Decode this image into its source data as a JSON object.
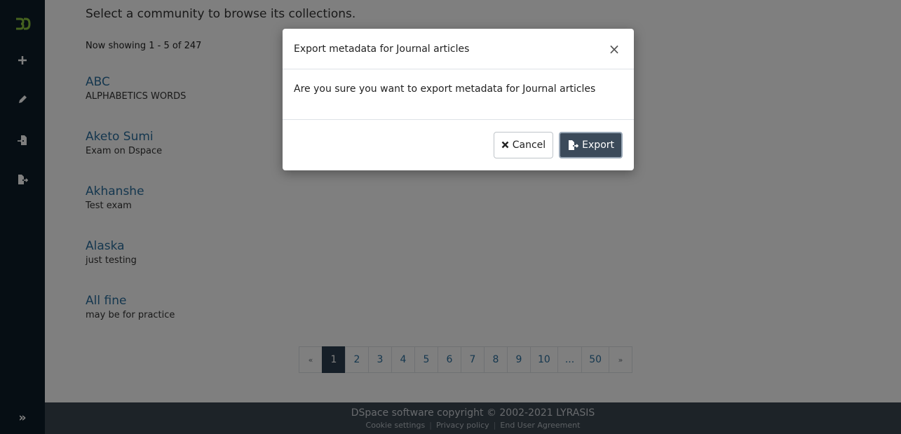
{
  "sidebar": {
    "expand_icon": "»"
  },
  "main": {
    "intro": "Select a community to browse its collections.",
    "showing": "Now showing 1 - 5 of 247",
    "items": [
      {
        "title": "ABC",
        "desc": "ALPHABETICS WORDS"
      },
      {
        "title": "Aketo Sumi",
        "desc": "Exam on Dspace"
      },
      {
        "title": "Akhanshe",
        "desc": "Test exam"
      },
      {
        "title": "Alaska",
        "desc": "just testing"
      },
      {
        "title": "All fine",
        "desc": "may be for practice"
      }
    ],
    "pagination": [
      "«",
      "1",
      "2",
      "3",
      "4",
      "5",
      "6",
      "7",
      "8",
      "9",
      "10",
      "...",
      "50",
      "»"
    ],
    "active_page": "1"
  },
  "footer": {
    "copyright": "DSpace software copyright © 2002-2021 LYRASIS",
    "cookie": "Cookie settings",
    "privacy": "Privacy policy",
    "agreement": "End User Agreement"
  },
  "modal": {
    "title": "Export metadata for Journal articles",
    "close": "×",
    "body": "Are you sure you want to export metadata for Journal articles",
    "cancel_label": "Cancel",
    "export_label": "Export"
  },
  "colors": {
    "sidebar": "#0d1c29",
    "link": "#2b6f9e",
    "logo": "#8cc63f",
    "primary": "#3b4a5a",
    "footer": "#3b4651"
  }
}
